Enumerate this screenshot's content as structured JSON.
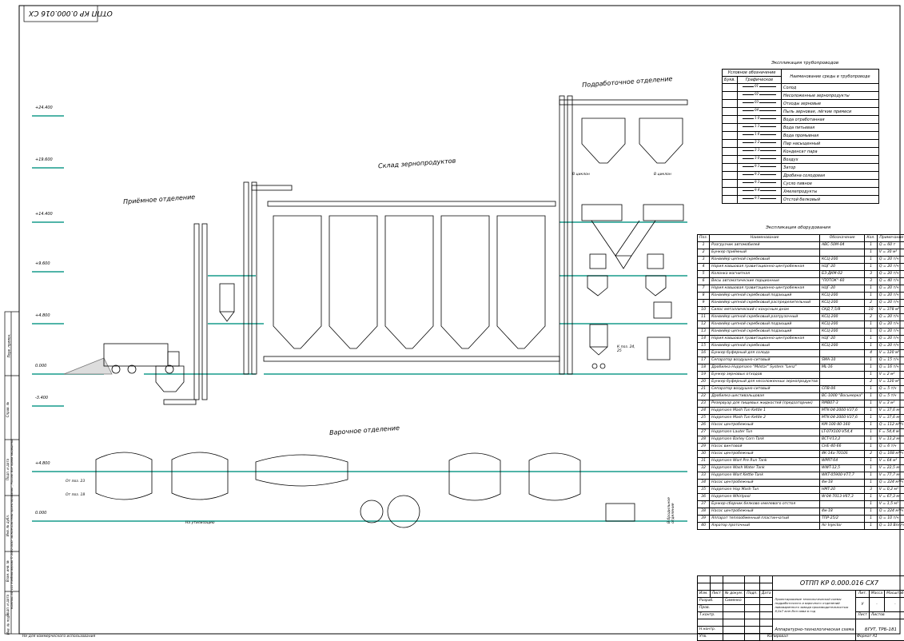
{
  "sheet": {
    "code_rotated": "ОТПП КР 0.000.016 СХ",
    "sections": {
      "receiving": "Приёмное отделение",
      "warehouse": "Склад зернопродуктов",
      "preparation": "Подработочное отделение",
      "brewing": "Варочное отделение"
    },
    "levels": [
      "+24.400",
      "+19.600",
      "+14.400",
      "+9.600",
      "+4.800",
      "0.000",
      "-3.400"
    ],
    "brew_levels": [
      "+4.800",
      "0.000"
    ],
    "notes": {
      "to_cyclone_1": "В циклон",
      "to_cyclone_2": "В циклон",
      "to_pos": "К поз. 24, 25",
      "from_pos_23": "От поз. 23",
      "from_pos_18": "От поз. 18",
      "to_disposal": "На утилизацию",
      "to_ferment": "В бродильное отделение"
    },
    "left_margin": {
      "perv": "Перв. примен.",
      "sprav": "Справ. №",
      "podp_date_1": "Подп. и дата",
      "inv_dubl": "Инв. № дубл.",
      "vzam_inv": "Взам. инв. №",
      "podp_date_2": "Подп. и дата",
      "inv_podl": "Инв. № подл.",
      "license": "КОМПАС-3D v21 Учебная версия © 2022 ООО \"АСКОН-Системы проектирования\", Россия. Все права защищены."
    },
    "footer": {
      "noncommercial": "Не для коммерческого использования",
      "copied": "Копировал",
      "format": "Формат A1"
    }
  },
  "legend": {
    "title": "Экспликация трубопроводов",
    "header": {
      "cond": "Условное обозначение",
      "bukv": "Букв.",
      "graph": "Графическое",
      "name": "Наименование среды в трубопроводе"
    },
    "rows": [
      {
        "code": "01",
        "name": "Солод"
      },
      {
        "code": "02",
        "name": "Несоложенные зернопродукты"
      },
      {
        "code": "03",
        "name": "Отходы зерновые"
      },
      {
        "code": "04",
        "name": "Пыль зерновая, лёгкие примеси"
      },
      {
        "code": "1.0",
        "name": "Вода отработанная"
      },
      {
        "code": "1.1",
        "name": "Вода питьевая"
      },
      {
        "code": "1.6",
        "name": "Вода промывная"
      },
      {
        "code": "2.2",
        "name": "Пар насыщенный"
      },
      {
        "code": "2.3",
        "name": "Конденсат пара"
      },
      {
        "code": "3.0",
        "name": "Воздух"
      },
      {
        "code": "9.1",
        "name": "Затор"
      },
      {
        "code": "9.2",
        "name": "Дробина солодовая"
      },
      {
        "code": "9.3",
        "name": "Сусло пивное"
      },
      {
        "code": "9.4",
        "name": "Хмелепродукты"
      },
      {
        "code": "9.5",
        "name": "Отстой белковый"
      }
    ]
  },
  "equipment": {
    "title": "Экспликация оборудования",
    "header": {
      "pos": "Поз.",
      "name": "Наименование",
      "mark": "Обозначение",
      "qty": "Кол.",
      "note": "Примечание"
    },
    "rows": [
      {
        "pos": "1",
        "name": "Разгрузчик автомобилей",
        "mark": "АВС-50М-04",
        "qty": "1",
        "note": "Q = 60 т"
      },
      {
        "pos": "2",
        "name": "Бункер приёмный",
        "mark": "",
        "qty": "1",
        "note": "V = 30 м³"
      },
      {
        "pos": "3",
        "name": "Конвейер цепной скребковый",
        "mark": "КСЦ-200",
        "qty": "1",
        "note": "Q = 20 т/ч"
      },
      {
        "pos": "4",
        "name": "Нория ковшовая гравитационно-центробежная",
        "mark": "НЦГ-20",
        "qty": "1",
        "note": "Q = 20 т/ч"
      },
      {
        "pos": "5",
        "name": "Колонка магнитная",
        "mark": "БЗ-ДКМ-02",
        "qty": "3",
        "note": "Q = 20 т/ч"
      },
      {
        "pos": "6",
        "name": "Весы автоматические порционные",
        "mark": "\"ПОТОК\"-60",
        "qty": "3",
        "note": "Q = 40 т/ч"
      },
      {
        "pos": "7",
        "name": "Нория ковшовая гравитационно-центробежная",
        "mark": "НЦГ-20",
        "qty": "1",
        "note": "Q = 20 т/ч"
      },
      {
        "pos": "8",
        "name": "Конвейер цепной скребковый подающий",
        "mark": "КСЦ-200",
        "qty": "1",
        "note": "Q = 20 т/ч"
      },
      {
        "pos": "9",
        "name": "Конвейер цепной скребковый распределительный",
        "mark": "КСЦ-200",
        "qty": "2",
        "note": "Q = 20 т/ч"
      },
      {
        "pos": "10",
        "name": "Силос металлический с конусным дном",
        "mark": "СКД 7,5/8",
        "qty": "10",
        "note": "V = 378 м³"
      },
      {
        "pos": "11",
        "name": "Конвейер цепной скребковый разгрузочный",
        "mark": "КСЦ-200",
        "qty": "2",
        "note": "Q = 20 т/ч"
      },
      {
        "pos": "12",
        "name": "Конвейер цепной скребковый подающий",
        "mark": "КСЦ-200",
        "qty": "1",
        "note": "Q = 20 т/ч"
      },
      {
        "pos": "13",
        "name": "Конвейер цепной скребковый подающий",
        "mark": "КСЦ-200",
        "qty": "1",
        "note": "Q = 20 т/ч"
      },
      {
        "pos": "14",
        "name": "Нория ковшовая гравитационно-центробежная",
        "mark": "НЦГ-20",
        "qty": "1",
        "note": "Q = 20 т/ч"
      },
      {
        "pos": "15",
        "name": "Конвейер цепной скребковый",
        "mark": "КСЦ-200",
        "qty": "1",
        "note": "Q = 20 т/ч"
      },
      {
        "pos": "16",
        "name": "Бункер буферный для солода",
        "mark": "",
        "qty": "4",
        "note": "V = 120 м³"
      },
      {
        "pos": "17",
        "name": "Сепаратор воздушно-ситовый",
        "mark": "SMA-10",
        "qty": "1",
        "note": "Q = 15 т/ч"
      },
      {
        "pos": "18",
        "name": "Дробилка Huppmann \"Milstar\" System \"Lenz\"",
        "mark": "ML-16",
        "qty": "1",
        "note": "Q = 16 т/ч"
      },
      {
        "pos": "19",
        "name": "Бункер зерновых отходов",
        "mark": "",
        "qty": "1",
        "note": "V = 2 м³"
      },
      {
        "pos": "20",
        "name": "Бункер буферный для несоложенных зернопродуктов",
        "mark": "",
        "qty": "2",
        "note": "V = 120 м³"
      },
      {
        "pos": "21",
        "name": "Сепаратор воздушно-ситовый",
        "mark": "СПВ-06",
        "qty": "1",
        "note": "Q = 5 т/ч"
      },
      {
        "pos": "22",
        "name": "Дробилка шестивальцовая",
        "mark": "ВС-1000 \"Восьмерка\"",
        "qty": "1",
        "note": "Q = 5 т/ч"
      },
      {
        "pos": "23",
        "name": "Резервуар для пищевых жидкостей (предзаторник)",
        "mark": "RMB07-3",
        "qty": "1",
        "note": "V = 3 м³"
      },
      {
        "pos": "24",
        "name": "Huppmann Mash Tun Kettle 1",
        "mark": "MTK-04-2000-V37,6",
        "qty": "1",
        "note": "V = 37,6 м³"
      },
      {
        "pos": "25",
        "name": "Huppmann Mash Tun Kettle 2",
        "mark": "MTK-04-2000-V37,6",
        "qty": "1",
        "note": "V = 37,6 м³"
      },
      {
        "pos": "26",
        "name": "Насос центробежный",
        "mark": "КМ-100-80-160",
        "qty": "1",
        "note": "Q = 112 м³/ч"
      },
      {
        "pos": "27",
        "name": "Huppmann Lauter Tun",
        "mark": "LT-07X100-V54,4",
        "qty": "1",
        "note": "F = 54,4 м²"
      },
      {
        "pos": "28",
        "name": "Huppmann Barley Corn Tank",
        "mark": "BCT-V13,2",
        "qty": "1",
        "note": "V = 13,2 м³"
      },
      {
        "pos": "29",
        "name": "Насос винтовой",
        "mark": "СНЕ-40-66",
        "qty": "1",
        "note": "Q = 6 т/ч"
      },
      {
        "pos": "30",
        "name": "Насос центробежный",
        "mark": "4К-14а-7010S",
        "qty": "2",
        "note": "Q = 168 м³/ч"
      },
      {
        "pos": "31",
        "name": "Huppmann Wort Pre Run Tank",
        "mark": "WPRT-64",
        "qty": "1",
        "note": "V = 64 м³"
      },
      {
        "pos": "32",
        "name": "Huppmann Wash Water Tank",
        "mark": "WWT-12,5",
        "qty": "1",
        "note": "V = 22,5 м³"
      },
      {
        "pos": "33",
        "name": "Huppmann Wort Kettle Tank",
        "mark": "WKT-05900-V77,7",
        "qty": "1",
        "note": "V = 77,7 м³"
      },
      {
        "pos": "34",
        "name": "Насос центробежный",
        "mark": "4м-18",
        "qty": "1",
        "note": "Q = 224 м³/ч"
      },
      {
        "pos": "35",
        "name": "Huppmann Hop Mash Tun",
        "mark": "HMT-20",
        "qty": "3",
        "note": "V = 0,2 м³"
      },
      {
        "pos": "36",
        "name": "Huppmann Whirlpool",
        "mark": "W-04-7013-V67,3",
        "qty": "1",
        "note": "V = 67,3 м³"
      },
      {
        "pos": "37",
        "name": "Бункер-сборник белково-хмелевого отстоя",
        "mark": "",
        "qty": "1",
        "note": "V = 1,5 м³"
      },
      {
        "pos": "38",
        "name": "Насос центробежный",
        "mark": "4м-18",
        "qty": "1",
        "note": "Q = 224 м³/ч"
      },
      {
        "pos": "39",
        "name": "Аппарат теплообменный пластинчатый",
        "mark": "ТПР-25/2",
        "qty": "1",
        "note": "Q = 10 т/ч"
      },
      {
        "pos": "40",
        "name": "Аэратор проточный",
        "mark": "Air Injector",
        "qty": "1",
        "note": "Q = 10 Впл/ч"
      }
    ]
  },
  "stamp": {
    "code": "ОТПП КР 0.000.016 СХ7",
    "description": "Проектирование технологической схемы подработочного и варочного отделений пивоваренного завода производительностью 8,0х7 млн Впл пива в год",
    "scheme": "Аппаратурно-технологическая схема",
    "org": "БГУТ, ТРБ-181",
    "cols": {
      "izm": "Изм.",
      "list": "Лист",
      "doc": "№ докум.",
      "podp": "Подп.",
      "data": "Дата"
    },
    "roles": {
      "razrab": "Разраб.",
      "prov": "Пров.",
      "tkontr": "Т.контр.",
      "nkontr": "Н.контр.",
      "utv": "Утв."
    },
    "developer": "Сименко",
    "lit_h": "Лит.",
    "mass_h": "Масса",
    "scale_h": "Масштаб",
    "lit": "У",
    "mass": "-",
    "scale": "-",
    "sheet_h": "Лист",
    "sheets_h": "Листов",
    "sheets": "1"
  }
}
